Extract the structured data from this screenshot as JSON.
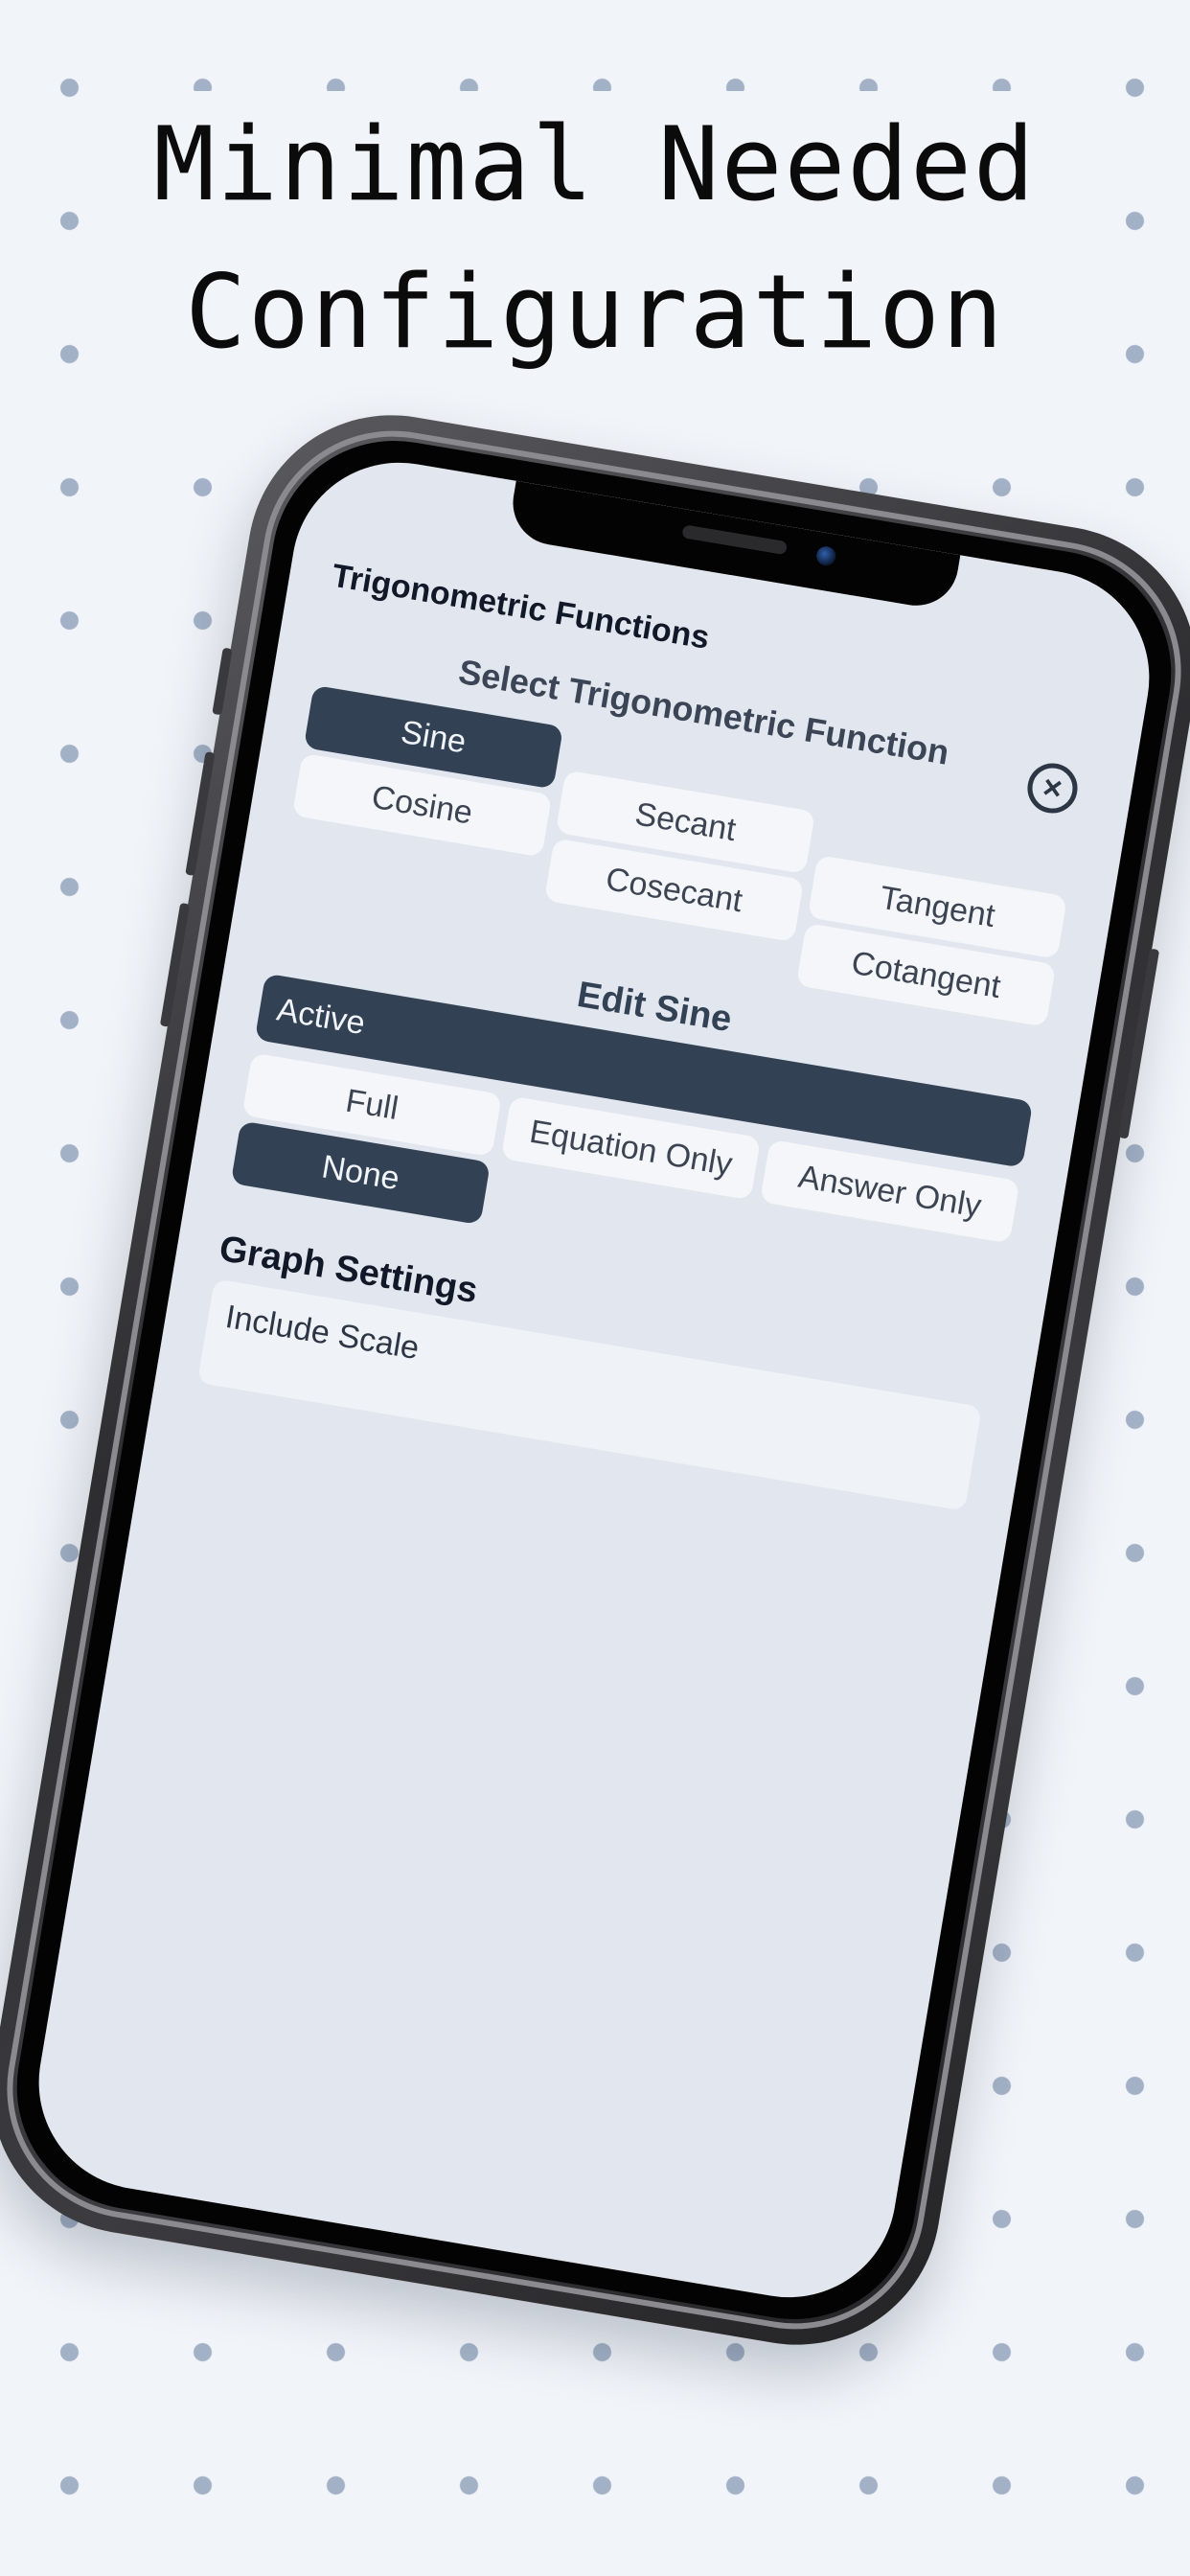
{
  "headline": {
    "line1": "Minimal Needed",
    "line2": "Configuration"
  },
  "app": {
    "title": "Trigonometric Functions",
    "close_icon": "close-icon",
    "select_heading": "Select Trigonometric Function",
    "functions": [
      {
        "label": "Sine",
        "selected": true
      },
      {
        "label": "Cosine",
        "selected": false
      },
      {
        "label": "Secant",
        "selected": false
      },
      {
        "label": "Cosecant",
        "selected": false
      },
      {
        "label": "Tangent",
        "selected": false
      },
      {
        "label": "Cotangent",
        "selected": false
      }
    ],
    "edit_heading": "Edit Sine",
    "active_label": "Active",
    "modes": [
      {
        "label": "Full",
        "selected": false
      },
      {
        "label": "None",
        "selected": true
      },
      {
        "label": "Equation Only",
        "selected": false
      },
      {
        "label": "Answer Only",
        "selected": false
      }
    ],
    "graph_heading": "Graph Settings",
    "include_scale_label": "Include Scale"
  },
  "colors": {
    "background": "#f1f4f9",
    "dot": "#a3b1c6",
    "accent": "#334155",
    "screen": "#e2e7ef",
    "pill": "#f4f6fa"
  }
}
